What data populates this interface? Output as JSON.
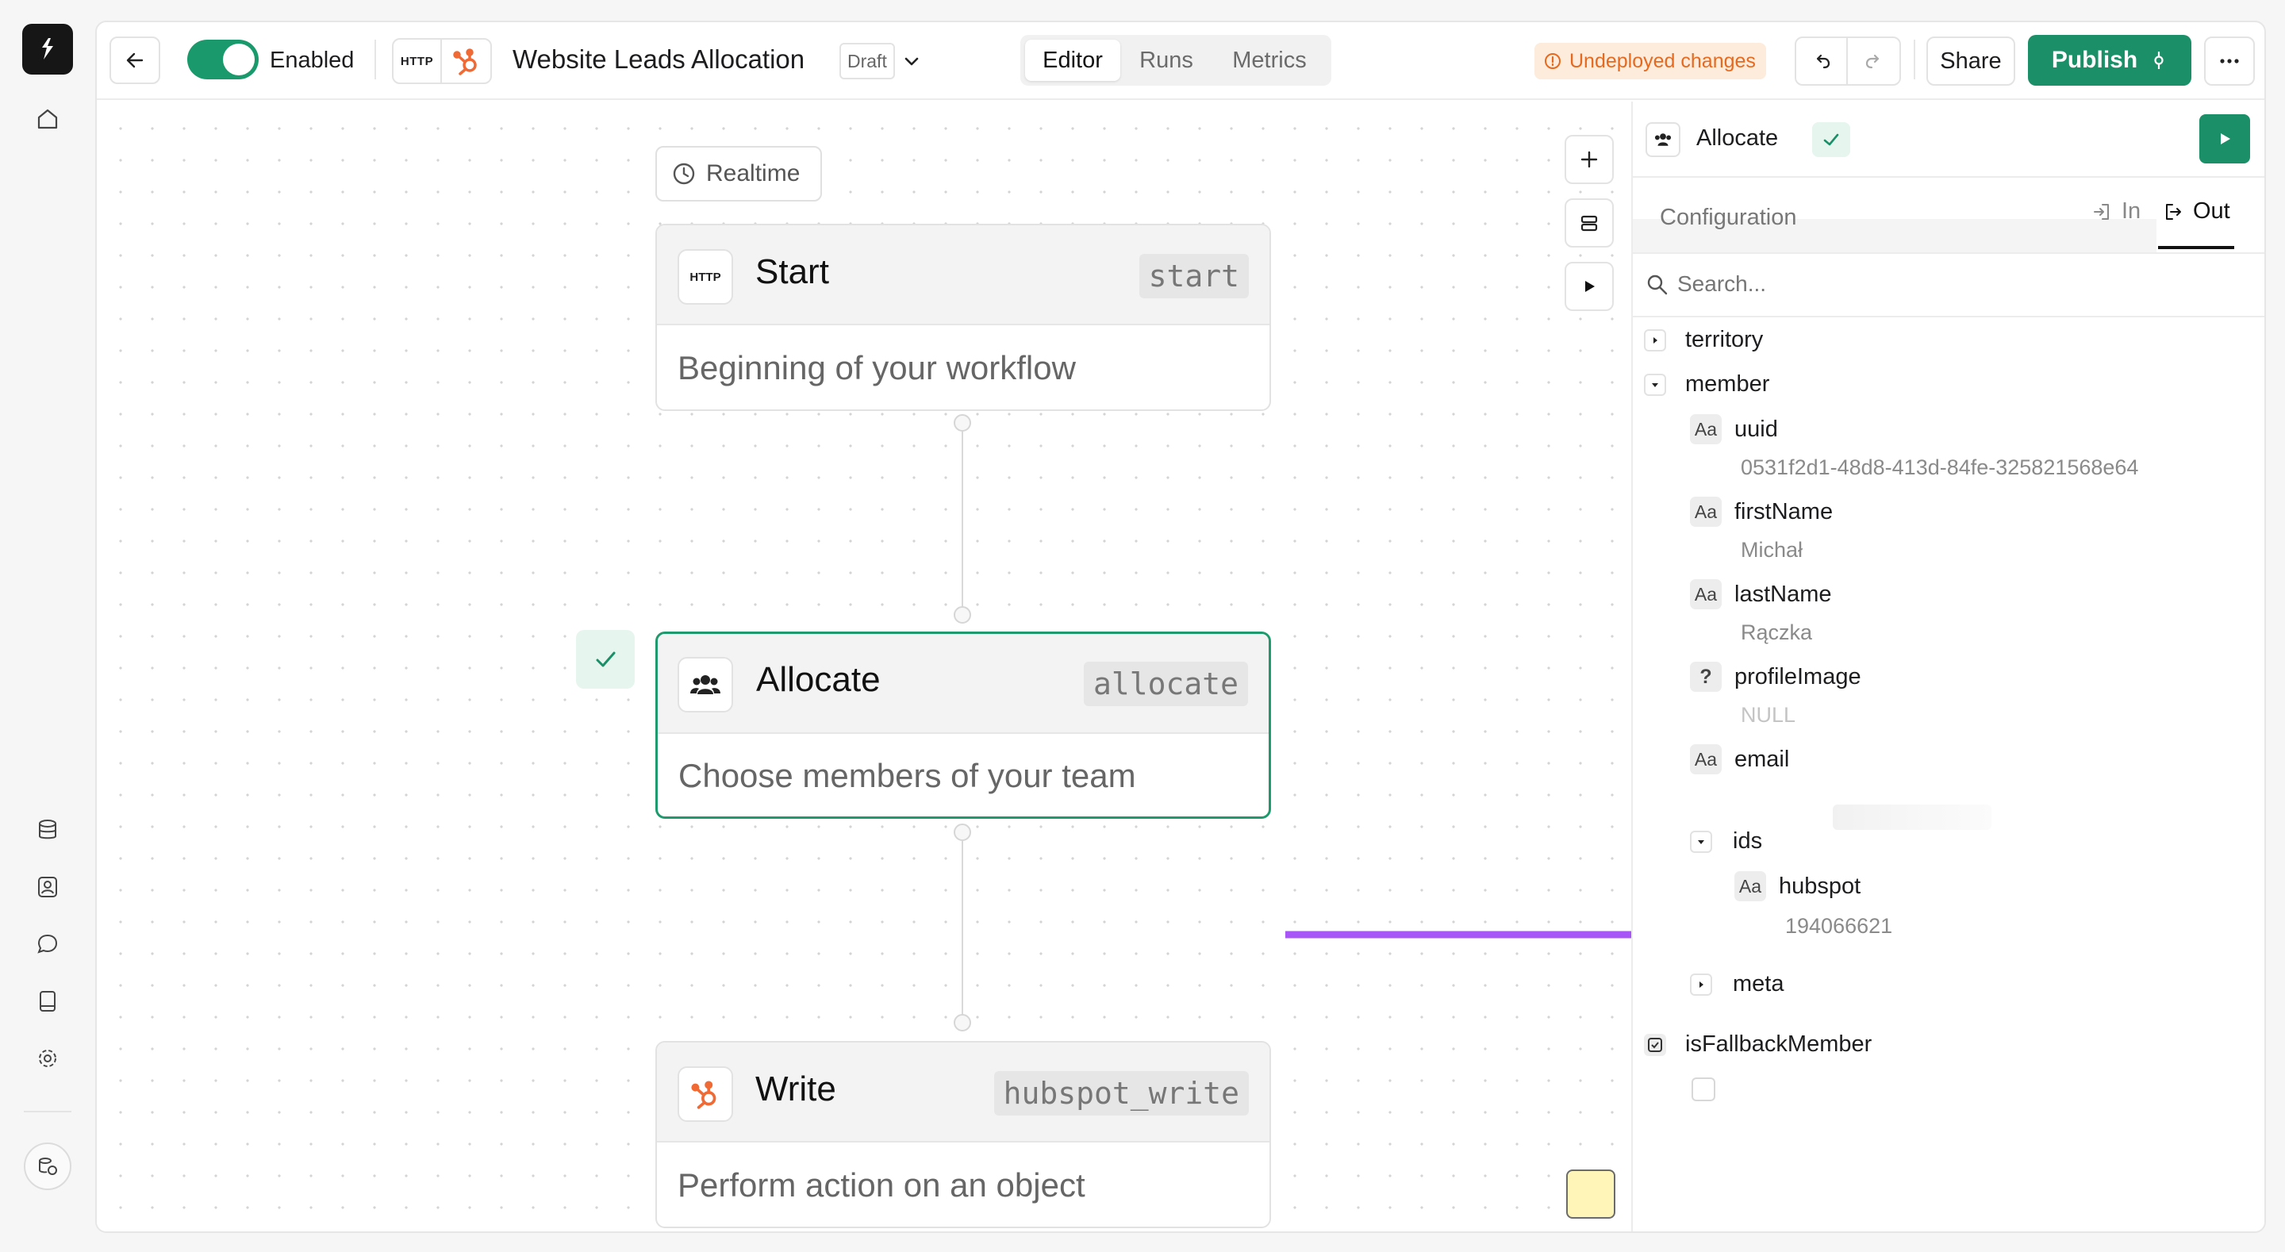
{
  "header": {
    "toggle_label": "Enabled",
    "toggle_on": true,
    "http_badge": "HTTP",
    "workflow_title": "Website Leads Allocation",
    "status_badge": "Draft",
    "tabs": [
      {
        "label": "Editor",
        "active": true
      },
      {
        "label": "Runs",
        "active": false
      },
      {
        "label": "Metrics",
        "active": false
      }
    ],
    "warning": "Undeployed changes",
    "share_label": "Share",
    "publish_label": "Publish",
    "accent_color": "#1a8f68",
    "warning_color": "#e56a1f"
  },
  "canvas": {
    "trigger_label": "Realtime",
    "nodes": [
      {
        "title": "Start",
        "key": "start",
        "description": "Beginning of your workflow",
        "icon": "http-icon"
      },
      {
        "title": "Allocate",
        "key": "allocate",
        "description": "Choose members of your team",
        "icon": "team-icon",
        "selected": true
      },
      {
        "title": "Write",
        "key": "hubspot_write",
        "description": "Perform action on an object",
        "icon": "hubspot-icon"
      }
    ]
  },
  "panel": {
    "title": "Allocate",
    "config_label": "Configuration",
    "in_label": "In",
    "out_label": "Out",
    "search_placeholder": "Search...",
    "tree": {
      "territory": "territory",
      "member": "member",
      "uuid_key": "uuid",
      "uuid_value": "0531f2d1-48d8-413d-84fe-325821568e64",
      "firstName_key": "firstName",
      "firstName_value": "Michał",
      "lastName_key": "lastName",
      "lastName_value": "Rączka",
      "profileImage_key": "profileImage",
      "profileImage_value": "NULL",
      "email_key": "email",
      "ids_key": "ids",
      "hubspot_key": "hubspot",
      "hubspot_value": "194066621",
      "meta_key": "meta",
      "isFallback_key": "isFallbackMember",
      "string_type": "Aa",
      "unknown_type": "?"
    }
  },
  "annotation": {
    "arrow_color": "#a855f7"
  }
}
